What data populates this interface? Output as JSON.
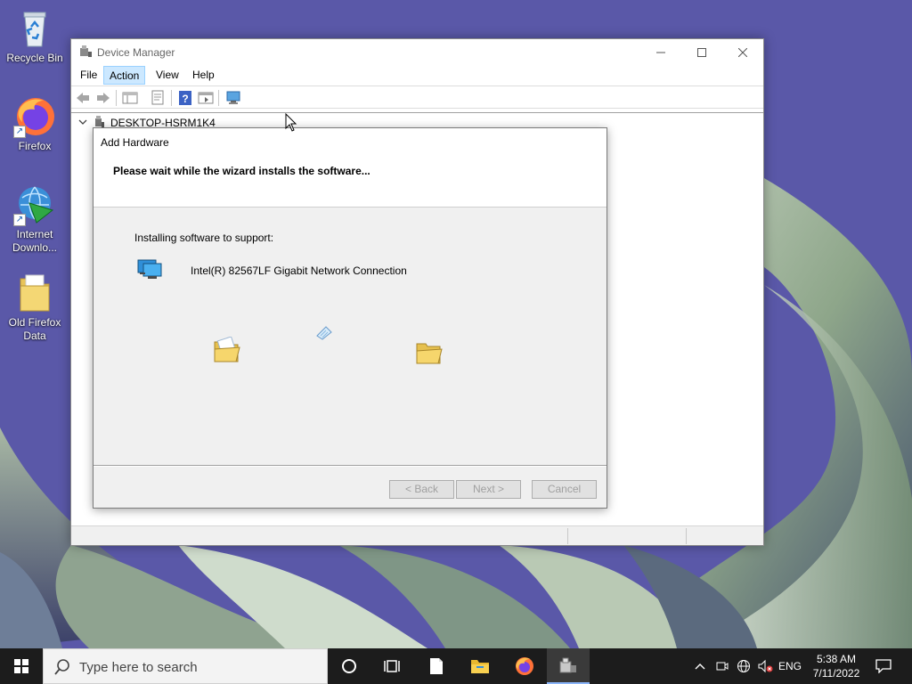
{
  "desktop": {
    "icons": [
      {
        "label_line1": "Recycle Bin",
        "label_line2": "",
        "icon": "recycle-bin-icon"
      },
      {
        "label_line1": "Firefox",
        "label_line2": "",
        "icon": "firefox-icon"
      },
      {
        "label_line1": "Internet",
        "label_line2": "Downlo...",
        "icon": "internet-download-manager-icon"
      },
      {
        "label_line1": "Old Firefox",
        "label_line2": "Data",
        "icon": "folder-icon"
      }
    ]
  },
  "device_manager": {
    "title": "Device Manager",
    "menu": [
      "File",
      "Action",
      "View",
      "Help"
    ],
    "active_menu": "Action",
    "toolbar_icons": [
      "back-arrow-icon",
      "forward-arrow-icon",
      "show-hide-tree-icon",
      "properties-icon",
      "help-icon",
      "update-driver-icon",
      "scan-hardware-icon"
    ],
    "tree_root": "DESKTOP-HSRM1K4"
  },
  "add_hardware": {
    "title": "Add Hardware",
    "heading": "Please wait while the wizard installs the software...",
    "installing_label": "Installing software to support:",
    "device_name": "Intel(R) 82567LF Gigabit Network Connection",
    "buttons": {
      "back": "< Back",
      "next": "Next >",
      "cancel": "Cancel"
    }
  },
  "taskbar": {
    "search_placeholder": "Type here to search",
    "apps": [
      "cortana-icon",
      "task-view-icon",
      "notepad-icon",
      "file-explorer-icon",
      "firefox-icon",
      "device-manager-icon"
    ],
    "active_app": "device-manager-icon",
    "language": "ENG",
    "time": "5:38 AM",
    "date": "7/11/2022"
  },
  "colors": {
    "wallpaper_bg": "#5a58a8",
    "menu_highlight": "#cce8ff",
    "taskbar": "#1c1c1c"
  }
}
